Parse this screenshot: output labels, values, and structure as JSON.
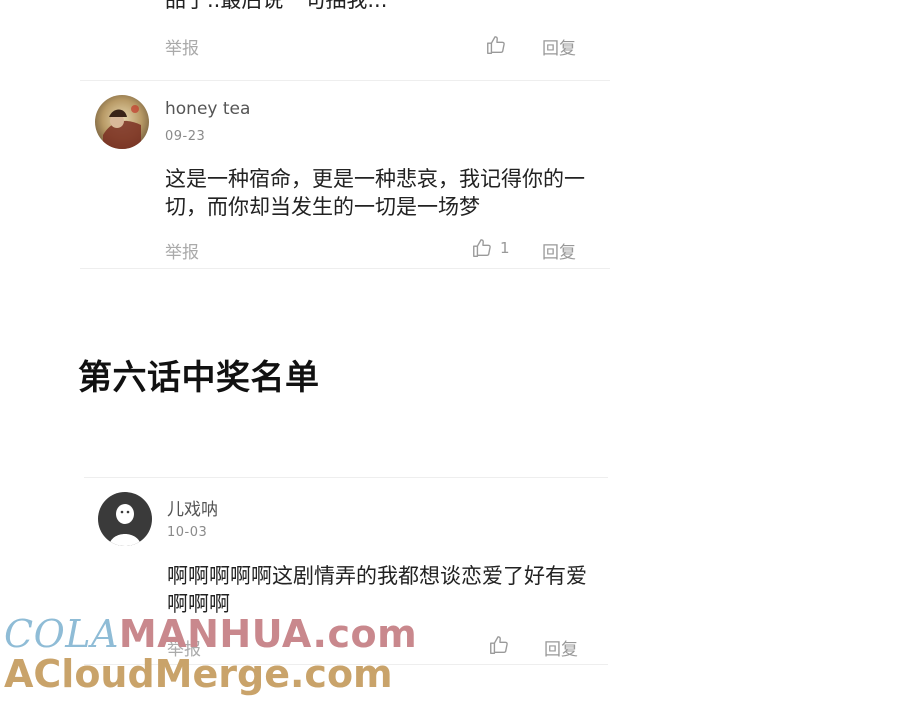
{
  "comment_top": {
    "content_partial": "品了..最后说一句抽我...",
    "report_label": "举报",
    "reply_label": "回复"
  },
  "comment_1": {
    "username": "honey tea",
    "date": "09-23",
    "content": "这是一种宿命，更是一种悲哀，我记得你的一切，而你却当发生的一切是一场梦",
    "report_label": "举报",
    "like_count": "1",
    "reply_label": "回复"
  },
  "section": {
    "title": "第六话中奖名单"
  },
  "comment_2": {
    "username": "儿戏呐",
    "date": "10-03",
    "content": "啊啊啊啊啊这剧情弄的我都想谈恋爱了好有爱啊啊啊",
    "report_label": "举报",
    "reply_label": "回复"
  },
  "watermark": {
    "line1_part1": "COLA",
    "line1_part2": "MANHUA",
    "line1_part3": ".com",
    "line2": "ACloudMerge.com"
  },
  "icons": {
    "like": "thumbs-up-icon",
    "avatar_default": "default-avatar-icon"
  },
  "colors": {
    "watermark_blue": "#8fbcd6",
    "watermark_pink": "#c9888d",
    "watermark_gold": "#c9a36a"
  }
}
